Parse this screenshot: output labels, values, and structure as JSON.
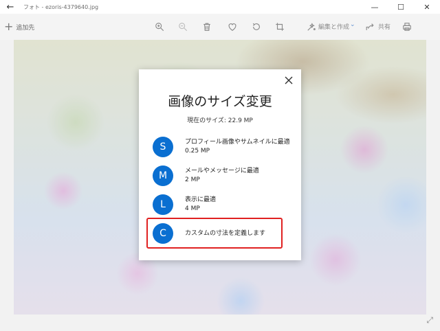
{
  "window": {
    "title": "フォト - ezoris-4379640.jpg",
    "back_glyph": "←",
    "minimize_glyph": "—",
    "maximize_glyph": "☐",
    "close_glyph": "✕"
  },
  "toolbar": {
    "add_to_label": "追加先",
    "edit_create_label": "編集と作成",
    "share_label": "共有"
  },
  "dialog": {
    "title": "画像のサイズ変更",
    "current_size": "現在のサイズ: 22.9 MP",
    "options": [
      {
        "letter": "S",
        "line1": "プロフィール画像やサムネイルに最適",
        "line2": "0.25 MP"
      },
      {
        "letter": "M",
        "line1": "メールやメッセージに最適",
        "line2": "2 MP"
      },
      {
        "letter": "L",
        "line1": "表示に最適",
        "line2": "4 MP"
      },
      {
        "letter": "C",
        "line1": "カスタムの寸法を定義します",
        "line2": ""
      }
    ]
  },
  "colors": {
    "accent": "#0a6fd1",
    "highlight": "#e02020"
  },
  "icons": [
    "back-arrow-icon",
    "zoom-in-icon",
    "zoom-out-icon",
    "delete-icon",
    "favorite-heart-icon",
    "rotate-icon",
    "crop-icon",
    "edit-create-icon",
    "share-icon",
    "print-icon",
    "expand-icon",
    "close-icon"
  ]
}
